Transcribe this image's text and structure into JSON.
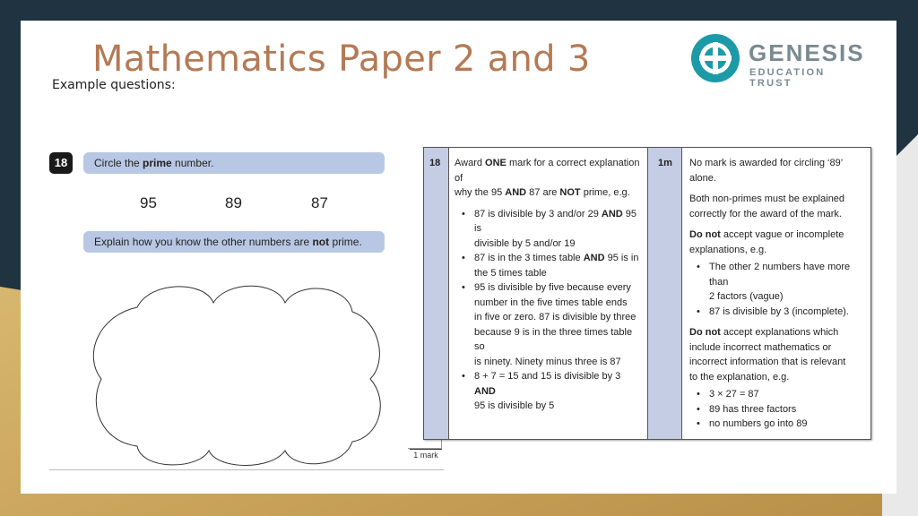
{
  "slide": {
    "title": "Mathematics Paper 2 and 3",
    "subtitle": "Example questions:",
    "logo": {
      "word": "GENESIS",
      "sub": "EDUCATION TRUST"
    }
  },
  "question": {
    "number": "18",
    "prompt_pre": "Circle the ",
    "prompt_bold": "prime",
    "prompt_post": " number.",
    "options": [
      "95",
      "89",
      "87"
    ],
    "explain_pre": "Explain how you know the other numbers are ",
    "explain_bold": "not",
    "explain_post": " prime.",
    "marks": "1 mark"
  },
  "mark_scheme": {
    "number": "18",
    "mark": "1m",
    "award_lines": [
      [
        "Award ",
        "ONE",
        " mark for a correct explanation of"
      ],
      [
        "why the 95 ",
        "AND",
        " 87 are ",
        "NOT",
        " prime, e.g."
      ]
    ],
    "examples": [
      [
        "87 is divisible by 3 and/or 29 ",
        "AND",
        " 95 is",
        "divisible by 5 and/or 19"
      ],
      [
        "87 is in the 3 times table ",
        "AND",
        " 95 is in",
        "the 5 times table"
      ],
      [
        "95 is divisible by five because every",
        "number in the five times table ends",
        "in five or zero. 87 is divisible by three",
        "because 9 is in the three times table so",
        "is ninety. Ninety minus three is 87"
      ],
      [
        "8 + 7 = 15 and 15 is divisible by 3 ",
        "AND",
        "95 is divisible by 5"
      ]
    ],
    "notes": {
      "no_mark": "No mark is awarded for circling ‘89’ alone.",
      "both_line1": "Both non-primes must be explained",
      "both_line2": "correctly for the award of the mark.",
      "do_not": "Do not",
      "vague_rest1": " accept vague or incomplete",
      "vague_rest2": "explanations, e.g.",
      "vague_examples": [
        "The other 2 numbers have more than",
        "2 factors (vague)",
        "87 is divisible by 3 (incomplete)."
      ],
      "incorrect_rest1": " accept explanations which",
      "incorrect_rest2": "include incorrect mathematics or",
      "incorrect_rest3": "incorrect information that is relevant",
      "incorrect_rest4": "to the explanation, e.g.",
      "incorrect_examples": [
        "3 × 27 = 87",
        "89 has three factors",
        "no numbers go into 89"
      ]
    }
  },
  "colors": {
    "accent": "#b47a55",
    "bar": "#b8c8e4",
    "table_shade": "#c4cde3",
    "logo_teal": "#1c9aa7"
  }
}
